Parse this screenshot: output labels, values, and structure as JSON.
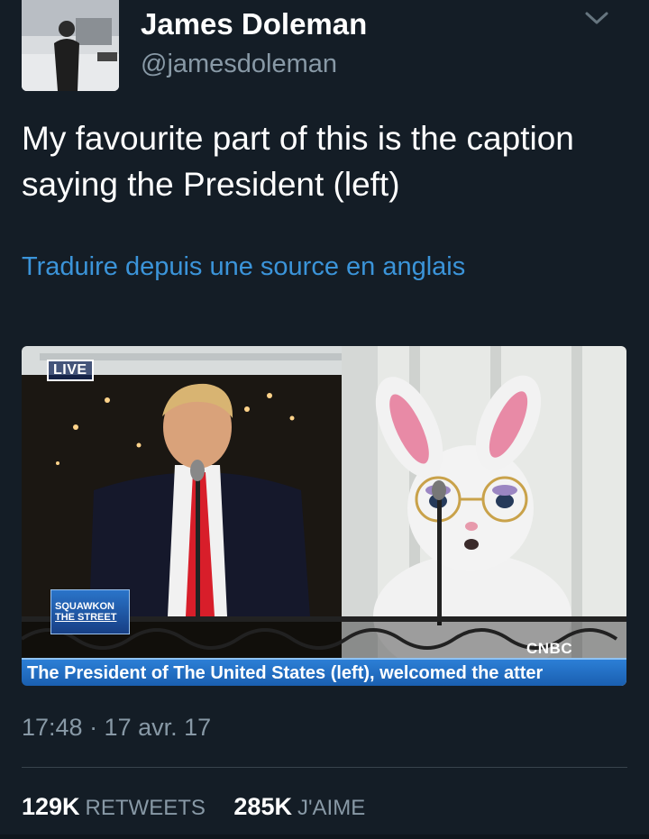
{
  "user": {
    "display_name": "James Doleman",
    "handle": "@jamesdoleman"
  },
  "tweet": {
    "text": "My favourite part of this is the caption saying the President (left)",
    "translate_link": "Traduire depuis une source en anglais",
    "timestamp": "17:48 · 17 avr. 17"
  },
  "media": {
    "live_badge": "LIVE",
    "show_logo_line1": "SQUAWKON",
    "show_logo_line2": "THE STREET",
    "network_logo": "CNBC",
    "caption": "The President of The United States (left), welcomed the atter"
  },
  "stats": {
    "retweets_count": "129K",
    "retweets_label": "RETWEETS",
    "likes_count": "285K",
    "likes_label": "J'AIME"
  },
  "colors": {
    "background": "#141d26",
    "secondary_text": "#8899a6",
    "link": "#3b94d9",
    "chyron_blue": "#1a5fb0"
  },
  "icons": {
    "more_options": "chevron-down-icon"
  }
}
